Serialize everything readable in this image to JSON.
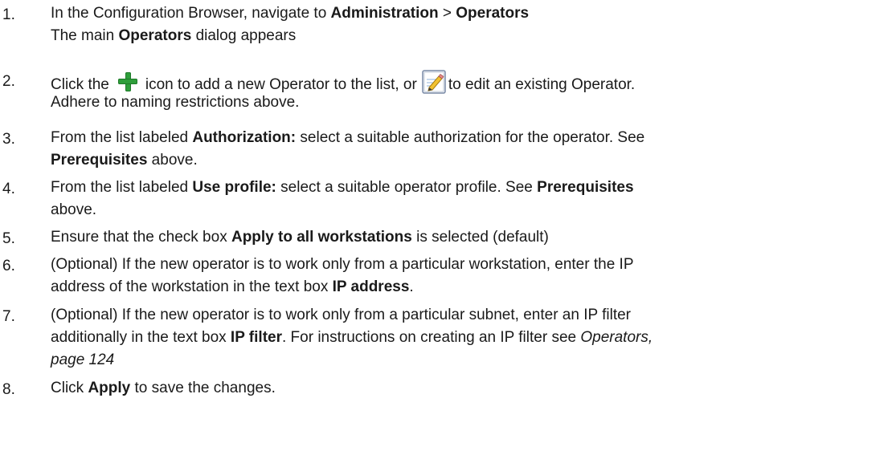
{
  "steps": [
    {
      "num": "1.",
      "line1": {
        "a": "In the Configuration Browser, navigate to ",
        "b": "Administration",
        "c": " > ",
        "d": "Operators"
      },
      "line2": {
        "a": "The main ",
        "b": "Operators",
        "c": " dialog appears"
      }
    },
    {
      "num": "2.",
      "line1": {
        "a": "Click the",
        "icon1": "add-plus-icon",
        "b": "icon to add a new Operator to the list, or",
        "icon2": "edit-pencil-icon",
        "c": "to edit an existing Operator."
      },
      "line2": {
        "a": "Adhere to naming restrictions above."
      }
    },
    {
      "num": "3.",
      "line1": {
        "a": "From the list labeled ",
        "b": "Authorization:",
        "c": " select a suitable authorization for the operator. See"
      },
      "line2": {
        "a": "Prerequisites",
        "b": " above."
      }
    },
    {
      "num": "4.",
      "line1": {
        "a": "From the list labeled ",
        "b": "Use profile:",
        "c": " select a suitable operator profile. See ",
        "d": "Prerequisites"
      },
      "line2": {
        "a": "above."
      }
    },
    {
      "num": "5.",
      "line1": {
        "a": "Ensure that the check box ",
        "b": "Apply to all workstations",
        "c": " is selected (default)"
      }
    },
    {
      "num": "6.",
      "line1": {
        "a": "(Optional) If the new operator is to work only from a particular workstation, enter the IP"
      },
      "line2": {
        "a": "address of the workstation in the text box ",
        "b": "IP address",
        "c": "."
      }
    },
    {
      "num": "7.",
      "line1": {
        "a": "(Optional) If the new operator is to work only from a particular subnet, enter an IP filter"
      },
      "line2": {
        "a": "additionally in the text box ",
        "b": "IP filter",
        "c": ". For instructions on creating an IP filter see ",
        "d": "Operators,"
      },
      "line3": {
        "a": "page 124"
      }
    },
    {
      "num": "8.",
      "line1": {
        "a": "Click ",
        "b": "Apply",
        "c": " to save the changes."
      }
    }
  ],
  "colors": {
    "text": "#1a1a1a",
    "icon_green": "#2e9e3a",
    "icon_frame": "#7a8aa6"
  }
}
